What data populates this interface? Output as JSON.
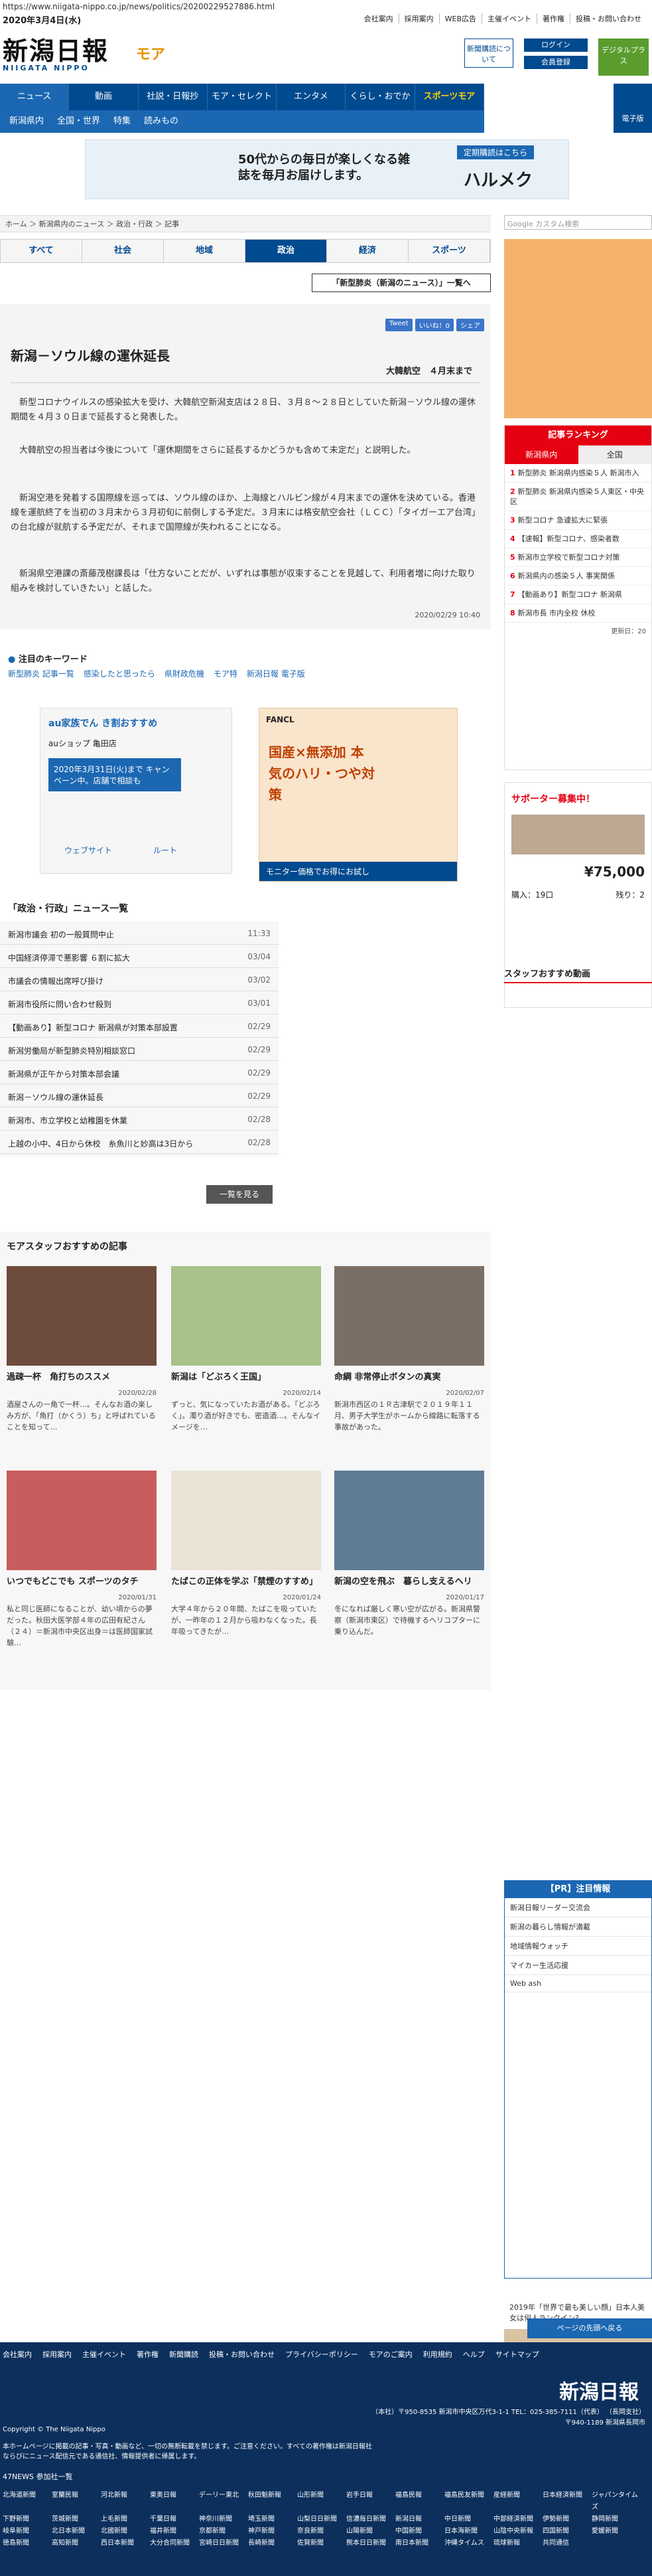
{
  "url": "https://www.niigata-nippo.co.jp/news/politics/20200229527886.html",
  "date": "2020年3月4日(水)",
  "toplinks": [
    "会社案内",
    "採用案内",
    "WEB広告",
    "主催イベント",
    "著作権",
    "投稿・お問い合わせ"
  ],
  "logo": {
    "main": "新潟日報",
    "sub": "NIIGATA NIPPO",
    "mo": "モア"
  },
  "header_buttons": {
    "subscribe": "新聞購読について",
    "login": "ログイン",
    "register": "会員登録",
    "digital": "デジタルプラス"
  },
  "nav": [
    "ニュース",
    "動画",
    "社説・日報抄",
    "モア・セレクト",
    "エンタメ",
    "くらし・おでかけ",
    "スポーツモア"
  ],
  "subnav": [
    "新潟県内",
    "全国・世界",
    "特集",
    "読みもの"
  ],
  "denshi": "電子版",
  "banner": {
    "text": "50代からの毎日が楽しくなる雑誌を毎月お届けします。",
    "brand": "ハルメク",
    "tag": "定期購読はこちら"
  },
  "breadcrumb": "ホーム ＞ 新潟県内のニュース ＞ 政治・行政 ＞ 記事",
  "tabs": [
    "すべて",
    "社会",
    "地域",
    "政治",
    "経済",
    "スポーツ"
  ],
  "list_button": "「新型肺炎（新潟のニュース）」一覧へ",
  "social": [
    "Tweet",
    "いいね！0",
    "シェア"
  ],
  "article": {
    "headline": "新潟－ソウル線の運休延長",
    "sub": "大韓航空　４月末まで",
    "paras": [
      "　新型コロナウイルスの感染拡大を受け、大韓航空新潟支店は２８日、３月８～２８日としていた新潟－ソウル線の運休期間を４月３０日まで延長すると発表した。",
      "　大韓航空の担当者は今後について「運休期間をさらに延長するかどうかも含めて未定だ」と説明した。",
      "　新潟空港を発着する国際線を巡っては、ソウル線のほか、上海線とハルビン線が４月末までの運休を決めている。香港線を運航終了を当初の３月末から３月初旬に前倒しする予定だ。３月末には格安航空会社（ＬＣＣ）「タイガーエア台湾」の台北線が就航する予定だが、それまで国際線が失われることになる。",
      "　新潟県空港課の斎藤茂樹課長は「仕方ないことだが、いずれは事態が収束することを見越して、利用者増に向けた取り組みを検討していきたい」と話した。"
    ],
    "datetime": "2020/02/29 10:40"
  },
  "keywords": {
    "title": "注目のキーワード",
    "items": [
      "新型肺炎 記事一覧",
      "感染したと思ったら",
      "県財政危機",
      "モア特",
      "新潟日報 電子版"
    ]
  },
  "ad1": {
    "title": "au家族でん き割おすすめ",
    "sub": "auショップ 亀田店",
    "notice": "2020年3月31日(火)まで キャンペーン中。店舗で相談も",
    "btn1": "ウェブサイト",
    "btn2": "ルート"
  },
  "ad2": {
    "brand": "FANCL",
    "copy": "国産×無添加 本気のハリ・つや対策",
    "cta": "モニター価格でお得にお試し"
  },
  "newslist": {
    "title": "「政治・行政」ニュース一覧",
    "rows": [
      {
        "t": "新潟市議会 初の一般質問中止",
        "d": "11:33"
      },
      {
        "t": "中国経済停滞で悪影響 ６割に拡大",
        "d": "03/04"
      },
      {
        "t": "市議会の情報出席呼び掛け",
        "d": "03/02"
      },
      {
        "t": "新潟市役所に問い合わせ殺到",
        "d": "03/01"
      },
      {
        "t": "【動画あり】新型コロナ 新潟県が対策本部設置",
        "d": "02/29"
      },
      {
        "t": "新潟労働局が新型肺炎特別相談窓口",
        "d": "02/29"
      },
      {
        "t": "新潟県が正午から対策本部会議",
        "d": "02/29"
      },
      {
        "t": "新潟－ソウル線の運休延長",
        "d": "02/29"
      },
      {
        "t": "新潟市、市立学校と幼稚園を休業",
        "d": "02/28"
      },
      {
        "t": "上越の小中、4日から休校　糸魚川と妙高は3日から",
        "d": "02/28"
      }
    ]
  },
  "more": "一覧を見る",
  "staff": {
    "title": "モアスタッフおすすめの記事",
    "cards": [
      {
        "t": "過疎一杯　角打ちのススメ",
        "d": "2020/02/28",
        "x": "酒屋さんの一角で一杯…。そんなお酒の楽しみ方が、「角打（かくう）ち」と呼ばれていることを知って…"
      },
      {
        "t": "新潟は「どぶろく王国」",
        "d": "2020/02/14",
        "x": "ずっと、気になっていたお酒がある。「どぶろく」。濁り酒が好きでも、密造酒…。そんなイメージを…"
      },
      {
        "t": "命綱 非常停止ボタンの真実",
        "d": "2020/02/07",
        "x": "新潟市西区の１Ｒ古津駅で２０１９年１１月、男子大学生がホームから線路に転落する事故があった。"
      },
      {
        "t": "いつでもどこでも スポーツのタチ",
        "d": "2020/01/31",
        "x": "私と同じ医師になることが、幼い頃からの夢だった。秋田大医学部４年の広田有紀さん（２４）＝新潟市中央区出身＝は医師国家試験…"
      },
      {
        "t": "たばこの正体を学ぶ「禁煙のすすめ」",
        "d": "2020/01/24",
        "x": "大学４年から２０年間、たばこを吸っていたが、一昨年の１２月から吸わなくなった。長年吸ってきたが…"
      },
      {
        "t": "新潟の空を飛ぶ　暮らし支えるヘリ",
        "d": "2020/01/17",
        "x": "冬になれば厳しく寒い空が広がる。新潟県警察（新潟市東区）で待機するヘリコプターに乗り込んだ。"
      }
    ]
  },
  "sidebar": {
    "search": "Google カスタム検索",
    "ranking": {
      "title": "記事ランキング",
      "tabs": [
        "新潟県内",
        "全国"
      ],
      "items": [
        "新型肺炎 新潟県内感染５人 新潟市入",
        "新型肺炎 新潟県内感染５人東区・中央区",
        "新型コロナ 急遽拡大に緊張",
        "【速報】新型コロナ、感染者数",
        "新潟市立学校で新型コロナ対策",
        "新潟県内の感染５人 事実関係",
        "【動画あり】新型コロナ 新潟県",
        "新潟市長 市内全校 休校"
      ],
      "updated": "更新日：20"
    },
    "furusato": {
      "title": "サポーター募集中！",
      "price": "¥75,000",
      "buyers": "購入：19口",
      "remain": "残り：2"
    },
    "pickup": "スタッフおすすめ動画",
    "pr_title": "【PR】注目情報",
    "pr_items": [
      "新潟日報リーダー交流会",
      "新潟の暮らし情報が満載",
      "地域情報ウォッチ",
      "マイカー生活応援",
      "Web ash"
    ],
    "beauty": "2019年「世界で最も美しい顔」日本人美女は何人ランクイン?",
    "pagetop": "ページの先頭へ戻る"
  },
  "footer": {
    "links": [
      "会社案内",
      "採用案内",
      "主催イベント",
      "著作権",
      "新聞購読",
      "投稿・お問い合わせ",
      "プライバシーポリシー",
      "モアのご案内",
      "利用規約",
      "ヘルプ",
      "サイトマップ"
    ],
    "logo": "新潟日報",
    "addr": "（本社）〒950-8535 新潟市中央区万代3-1-1 TEL：025-385-7111（代表） （長岡支社）〒940-1189 新潟県長岡市",
    "copyright": "Copyright © The Niigata Nippo",
    "note": "本ホームページに掲載の記事・写真・動画など、一切の無断転載を禁じます。ご注意ください。すべての著作権は新潟日報社ならびにニュース配信元である通信社、情報提供者に帰属します。",
    "n47": "47NEWS 参加社一覧",
    "papers": [
      "北海道新聞",
      "室蘭民報",
      "河北新報",
      "東奥日報",
      "デーリー東北",
      "秋田魁新報",
      "山形新聞",
      "岩手日報",
      "福島民報",
      "福島民友新聞",
      "産経新聞",
      "日本経済新聞",
      "ジャパンタイムズ",
      "下野新聞",
      "茨城新聞",
      "上毛新聞",
      "千葉日報",
      "神奈川新聞",
      "埼玉新聞",
      "山梨日日新聞",
      "信濃毎日新聞",
      "新潟日報",
      "中日新聞",
      "中部経済新聞",
      "伊勢新聞",
      "静岡新聞",
      "岐阜新聞",
      "北日本新聞",
      "北國新聞",
      "福井新聞",
      "京都新聞",
      "神戸新聞",
      "奈良新聞",
      "山陽新聞",
      "中国新聞",
      "日本海新聞",
      "山陰中央新報",
      "四国新聞",
      "愛媛新聞",
      "徳島新聞",
      "高知新聞",
      "西日本新聞",
      "大分合同新聞",
      "宮崎日日新聞",
      "長崎新聞",
      "佐賀新聞",
      "熊本日日新聞",
      "南日本新聞",
      "沖縄タイムス",
      "琉球新報",
      "共同通信"
    ]
  }
}
